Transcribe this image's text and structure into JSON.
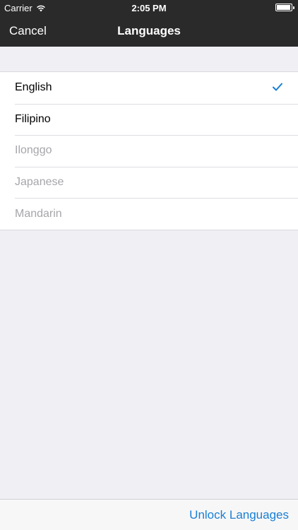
{
  "status_bar": {
    "carrier": "Carrier",
    "time": "2:05 PM"
  },
  "nav": {
    "cancel_label": "Cancel",
    "title": "Languages"
  },
  "languages": [
    {
      "label": "English",
      "enabled": true,
      "selected": true
    },
    {
      "label": "Filipino",
      "enabled": true,
      "selected": false
    },
    {
      "label": "Ilonggo",
      "enabled": false,
      "selected": false
    },
    {
      "label": "Japanese",
      "enabled": false,
      "selected": false
    },
    {
      "label": "Mandarin",
      "enabled": false,
      "selected": false
    }
  ],
  "toolbar": {
    "unlock_label": "Unlock Languages"
  },
  "colors": {
    "accent": "#1a7fd4",
    "nav_background": "#2a2a2a",
    "disabled_text": "#a6a6ab",
    "page_background": "#efeff4"
  }
}
